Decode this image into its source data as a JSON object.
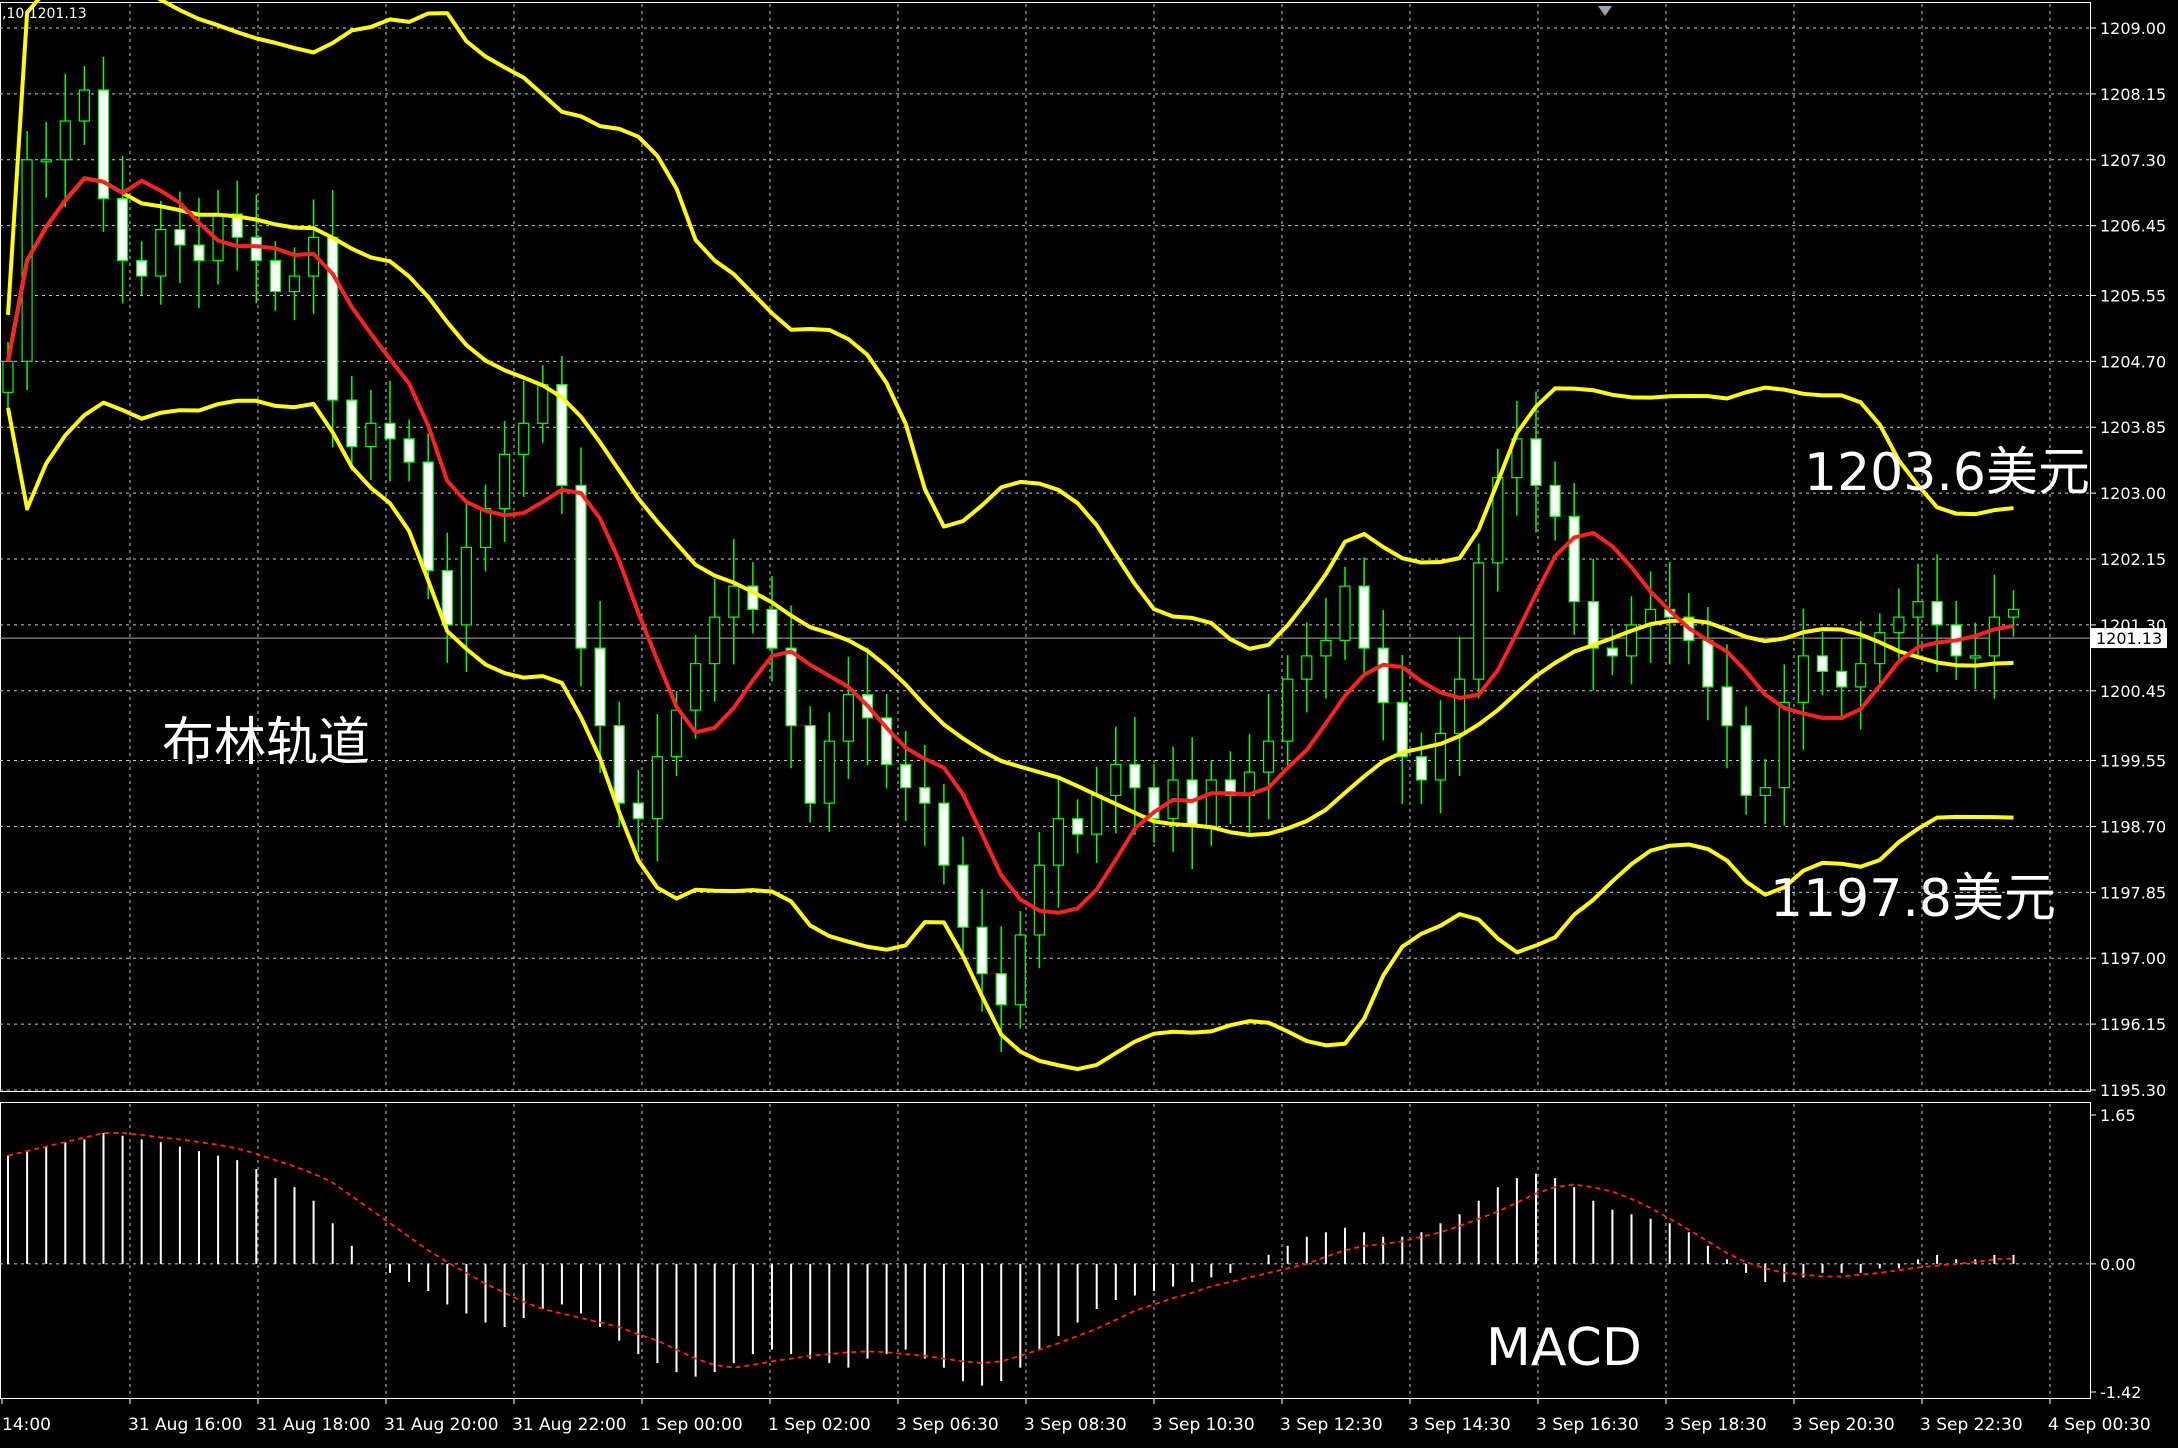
{
  "header": {
    "ohlc_text": ",10 1201.13"
  },
  "annotations": {
    "bollinger": "布林轨道",
    "upper_value": "1203.6美元",
    "lower_value": "1197.8美元",
    "macd": "MACD"
  },
  "colors": {
    "background": "#000000",
    "grid": "#c8c8c8",
    "axis": "#ffffff",
    "candle": "#00ff00",
    "bollinger": "#ffff00",
    "moving_average": "#ff2020",
    "macd_histogram": "#ffffff",
    "macd_signal": "#ff2020"
  },
  "chart_data": [
    {
      "type": "candlestick",
      "title": "",
      "ylim": [
        1195.3,
        1209.0
      ],
      "yticks": [
        "1209.00",
        "1208.15",
        "1207.30",
        "1206.45",
        "1205.55",
        "1204.70",
        "1203.85",
        "1203.00",
        "1202.15",
        "1201.30",
        "1200.45",
        "1199.55",
        "1198.70",
        "1197.85",
        "1197.00",
        "1196.15",
        "1195.30"
      ],
      "current_price": "1201.13",
      "xticks": [
        "14:00",
        "31 Aug 16:00",
        "31 Aug 18:00",
        "31 Aug 20:00",
        "31 Aug 22:00",
        "1 Sep 00:00",
        "1 Sep 02:00",
        "3 Sep 06:30",
        "3 Sep 08:30",
        "3 Sep 10:30",
        "3 Sep 12:30",
        "3 Sep 14:30",
        "3 Sep 16:30",
        "3 Sep 18:30",
        "3 Sep 20:30",
        "3 Sep 22:30",
        "4 Sep 00:30"
      ],
      "close": [
        1204.7,
        1207.3,
        1207.3,
        1207.8,
        1208.2,
        1206.8,
        1206.0,
        1205.8,
        1206.4,
        1206.2,
        1206.0,
        1206.6,
        1206.3,
        1206.0,
        1205.6,
        1205.8,
        1206.3,
        1204.2,
        1203.6,
        1203.9,
        1203.7,
        1203.4,
        1202.0,
        1201.3,
        1202.3,
        1202.8,
        1203.5,
        1203.9,
        1204.4,
        1203.1,
        1201.0,
        1200.0,
        1199.0,
        1198.8,
        1199.6,
        1200.2,
        1200.8,
        1201.4,
        1201.8,
        1201.5,
        1201.0,
        1200.0,
        1199.0,
        1199.8,
        1200.4,
        1200.1,
        1199.5,
        1199.2,
        1199.0,
        1198.2,
        1197.4,
        1196.8,
        1196.4,
        1197.3,
        1198.2,
        1198.8,
        1198.6,
        1199.1,
        1199.5,
        1199.2,
        1198.8,
        1199.3,
        1198.7,
        1199.3,
        1199.1,
        1199.4,
        1199.8,
        1200.6,
        1200.9,
        1201.1,
        1201.8,
        1201.0,
        1200.3,
        1199.6,
        1199.3,
        1199.9,
        1200.6,
        1202.1,
        1203.2,
        1203.7,
        1203.1,
        1202.7,
        1201.6,
        1201.0,
        1200.9,
        1201.3,
        1201.5,
        1201.4,
        1201.1,
        1200.5,
        1200.0,
        1199.1,
        1199.2,
        1200.3,
        1200.9,
        1200.7,
        1200.5,
        1200.8,
        1201.2,
        1201.4,
        1201.6,
        1201.3,
        1200.9,
        1200.9,
        1201.4,
        1201.5
      ]
    },
    {
      "type": "macd",
      "ylim": [
        -1.42,
        1.65
      ],
      "yticks": [
        "1.65",
        "0.00",
        "-1.42"
      ],
      "histogram": [
        1.2,
        1.25,
        1.3,
        1.35,
        1.38,
        1.45,
        1.42,
        1.38,
        1.35,
        1.3,
        1.25,
        1.2,
        1.15,
        1.05,
        0.95,
        0.85,
        0.7,
        0.45,
        0.2,
        0.0,
        -0.1,
        -0.2,
        -0.3,
        -0.45,
        -0.55,
        -0.65,
        -0.7,
        -0.6,
        -0.5,
        -0.45,
        -0.55,
        -0.7,
        -0.85,
        -1.0,
        -1.1,
        -1.2,
        -1.25,
        -1.2,
        -1.1,
        -1.0,
        -0.95,
        -1.0,
        -1.05,
        -1.1,
        -1.15,
        -1.05,
        -1.0,
        -0.95,
        -1.05,
        -1.15,
        -1.3,
        -1.35,
        -1.3,
        -1.15,
        -0.95,
        -0.8,
        -0.65,
        -0.5,
        -0.4,
        -0.35,
        -0.3,
        -0.25,
        -0.2,
        -0.15,
        -0.1,
        0.0,
        0.1,
        0.2,
        0.3,
        0.35,
        0.4,
        0.35,
        0.3,
        0.3,
        0.35,
        0.45,
        0.55,
        0.7,
        0.85,
        0.95,
        1.0,
        0.95,
        0.85,
        0.7,
        0.6,
        0.55,
        0.5,
        0.45,
        0.35,
        0.2,
        0.05,
        -0.1,
        -0.2,
        -0.2,
        -0.15,
        -0.1,
        -0.1,
        -0.1,
        -0.05,
        -0.05,
        0.05,
        0.1,
        0.05,
        0.05,
        0.1,
        0.1
      ],
      "signal": [
        1.2,
        1.25,
        1.3,
        1.35,
        1.4,
        1.45,
        1.45,
        1.43,
        1.4,
        1.38,
        1.35,
        1.32,
        1.28,
        1.22,
        1.15,
        1.08,
        1.0,
        0.9,
        0.75,
        0.6,
        0.45,
        0.3,
        0.15,
        0.02,
        -0.1,
        -0.22,
        -0.32,
        -0.42,
        -0.5,
        -0.55,
        -0.6,
        -0.65,
        -0.7,
        -0.78,
        -0.85,
        -0.95,
        -1.05,
        -1.12,
        -1.15,
        -1.12,
        -1.08,
        -1.05,
        -1.02,
        -1.0,
        -0.98,
        -0.97,
        -0.98,
        -1.0,
        -1.02,
        -1.05,
        -1.08,
        -1.1,
        -1.08,
        -1.02,
        -0.95,
        -0.88,
        -0.8,
        -0.72,
        -0.62,
        -0.52,
        -0.45,
        -0.38,
        -0.32,
        -0.25,
        -0.2,
        -0.15,
        -0.1,
        -0.05,
        0.0,
        0.08,
        0.15,
        0.2,
        0.22,
        0.25,
        0.3,
        0.35,
        0.42,
        0.5,
        0.58,
        0.68,
        0.78,
        0.85,
        0.88,
        0.85,
        0.8,
        0.72,
        0.62,
        0.5,
        0.38,
        0.25,
        0.12,
        0.02,
        -0.05,
        -0.1,
        -0.12,
        -0.14,
        -0.14,
        -0.12,
        -0.1,
        -0.07,
        -0.04,
        -0.02,
        0.0,
        0.02,
        0.05,
        0.06
      ]
    }
  ]
}
